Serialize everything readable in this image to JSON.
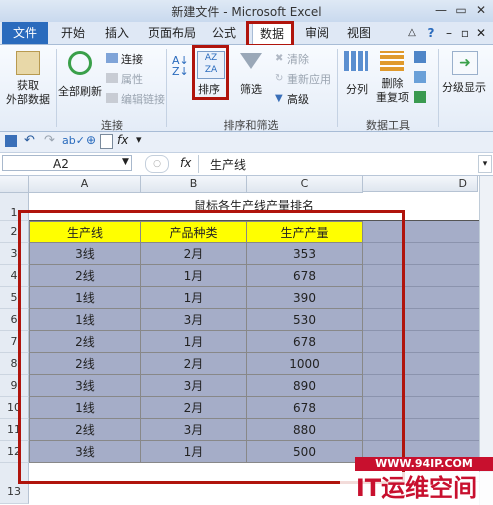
{
  "window": {
    "title": "新建文件 - Microsoft Excel"
  },
  "tabs": [
    "文件",
    "开始",
    "插入",
    "页面布局",
    "公式",
    "数据",
    "审阅",
    "视图"
  ],
  "ribbon": {
    "get_external": "获取\n外部数据",
    "refresh_all": "全部刷新",
    "connections": "连接",
    "properties": "属性",
    "edit_links": "编辑链接",
    "group_connections": "连接",
    "sort": "排序",
    "filter": "筛选",
    "clear": "清除",
    "reapply": "重新应用",
    "advanced": "高级",
    "group_sort_filter": "排序和筛选",
    "text_to_columns": "分列",
    "remove_duplicates": "删除\n重复项",
    "group_data_tools": "数据工具",
    "outline": "分级显示"
  },
  "namebox": "A2",
  "formula": "生产线",
  "columns": [
    "A",
    "B",
    "C",
    "D"
  ],
  "rows": [
    "1",
    "2",
    "3",
    "4",
    "5",
    "6",
    "7",
    "8",
    "9",
    "10",
    "11",
    "12",
    "13"
  ],
  "sheet_title": "鼠标各生产线产量排名",
  "table": {
    "headers": [
      "生产线",
      "产品种类",
      "生产产量"
    ],
    "rows": [
      [
        "3线",
        "2月",
        "353"
      ],
      [
        "2线",
        "1月",
        "678"
      ],
      [
        "1线",
        "1月",
        "390"
      ],
      [
        "1线",
        "3月",
        "530"
      ],
      [
        "2线",
        "1月",
        "678"
      ],
      [
        "2线",
        "2月",
        "1000"
      ],
      [
        "3线",
        "3月",
        "890"
      ],
      [
        "1线",
        "2月",
        "678"
      ],
      [
        "2线",
        "3月",
        "880"
      ],
      [
        "3线",
        "1月",
        "500"
      ]
    ]
  },
  "watermark": {
    "url": "WWW.94IP.COM",
    "name": "IT运维空间"
  },
  "colors": {
    "header_fill": "#ffff00",
    "data_fill": "#a5adc8",
    "highlight": "#b0140c",
    "file_tab": "#2a6bbd"
  }
}
